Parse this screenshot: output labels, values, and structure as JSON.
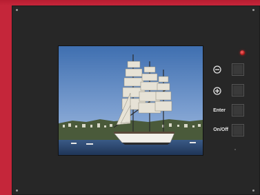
{
  "controls": {
    "minus_label": "⊖",
    "plus_label": "⊕",
    "enter_label": "Enter",
    "onoff_label": "On/Off"
  },
  "colors": {
    "case": "#c5263a",
    "bezel": "#272727",
    "led": "#e02020"
  },
  "screen": {
    "content": "tall-ship-photo"
  }
}
